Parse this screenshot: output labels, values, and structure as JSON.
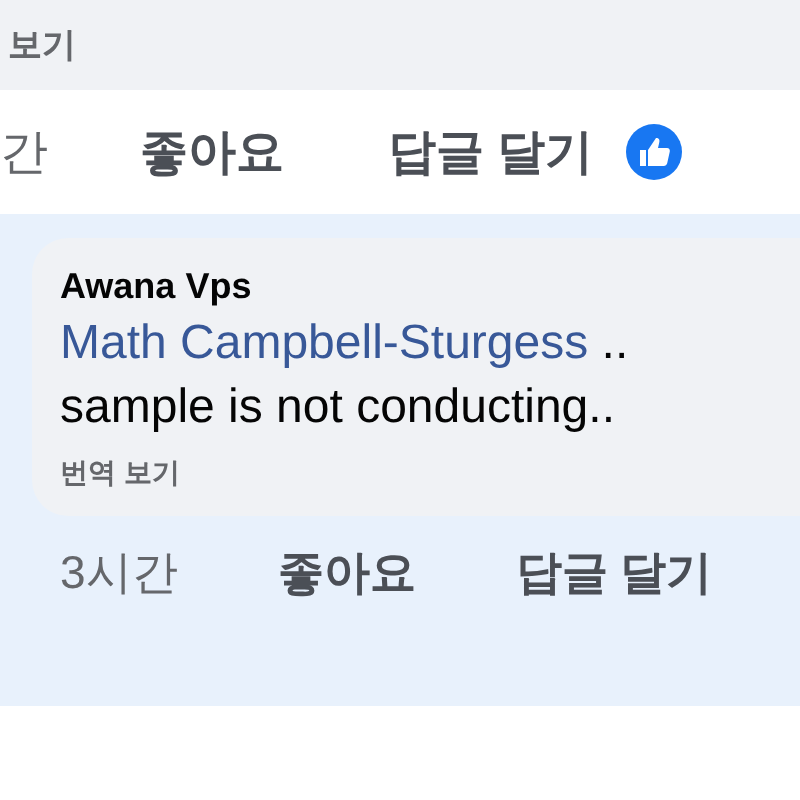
{
  "previous_comment": {
    "see_translation": "보기"
  },
  "previous_actions": {
    "time": "간",
    "like": "좋아요",
    "reply": "답글 달기"
  },
  "comment": {
    "author": "Awana Vps",
    "mention": "Math Campbell-Sturgess",
    "mention_tail": " ..",
    "text": "sample is not conducting..",
    "see_translation": "번역 보기",
    "actions": {
      "time": "3시간",
      "like": "좋아요",
      "reply": "답글 달기"
    }
  }
}
